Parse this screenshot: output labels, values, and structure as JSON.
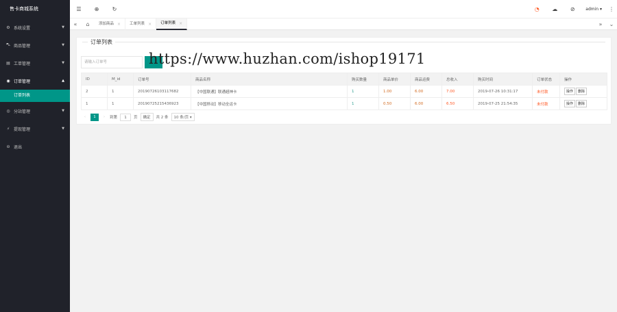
{
  "app": {
    "title": "售卡商城系统"
  },
  "sidebar": {
    "items": [
      {
        "label": "系统设置",
        "icon": "gear-icon"
      },
      {
        "label": "商品管理",
        "icon": "cart-icon"
      },
      {
        "label": "工单管理",
        "icon": "ticket-icon"
      },
      {
        "label": "订单管理",
        "icon": "order-icon",
        "active_sub": "订单列表"
      },
      {
        "label": "分站管理",
        "icon": "site-icon"
      },
      {
        "label": "提现管理",
        "icon": "withdraw-icon"
      },
      {
        "label": "退出",
        "icon": "logout-icon"
      }
    ]
  },
  "header": {
    "user": "admin"
  },
  "tabs": [
    {
      "label": "添加商品"
    },
    {
      "label": "工单列表"
    },
    {
      "label": "订单列表",
      "active": true
    }
  ],
  "panel": {
    "title": "订单列表",
    "search_placeholder": "请输入订单号"
  },
  "watermark": "https://www.huzhan.com/ishop19171",
  "table": {
    "headers": [
      "ID",
      "M_id",
      "订单号",
      "商品名称",
      "购买数量",
      "商品单价",
      "商品运费",
      "总收入",
      "购买时间",
      "订单状态",
      "操作"
    ],
    "rows": [
      {
        "id": "2",
        "mid": "1",
        "order_no": "20190726103117682",
        "name": "【中国联通】联通超神卡",
        "qty": "1",
        "price": "1.00",
        "shipping": "6.00",
        "total": "7.00",
        "time": "2019-07-26 10:31:17",
        "status": "未付款"
      },
      {
        "id": "1",
        "mid": "1",
        "order_no": "20190725215436923",
        "name": "【中国移动】移动全运卡",
        "qty": "1",
        "price": "0.50",
        "shipping": "6.00",
        "total": "6.50",
        "time": "2019-07-25 21:54:35",
        "status": "未付款"
      }
    ],
    "actions": {
      "op": "操作",
      "del": "删除"
    }
  },
  "pager": {
    "current": "1",
    "goto_label": "到第",
    "page_input": "1",
    "page_unit": "页",
    "confirm": "确定",
    "total": "共 2 条",
    "size": "10 条/页"
  }
}
